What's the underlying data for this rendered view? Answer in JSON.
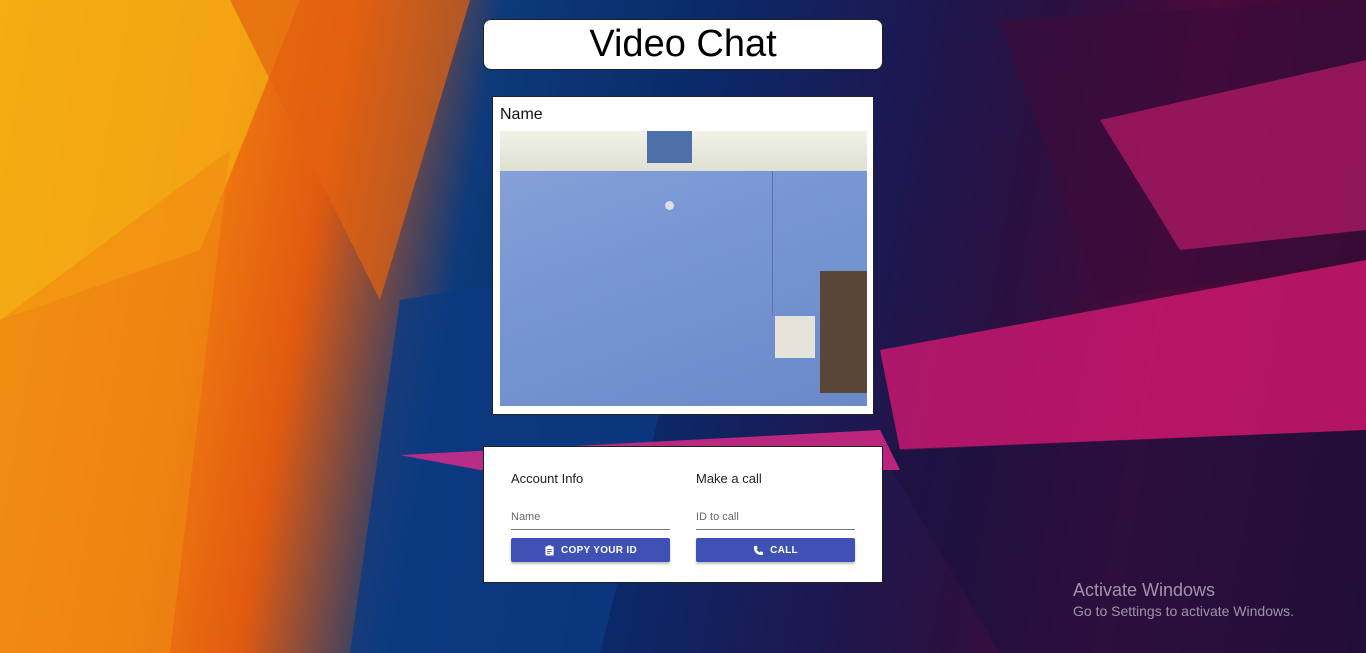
{
  "header": {
    "title": "Video Chat"
  },
  "video": {
    "name_label": "Name"
  },
  "account": {
    "title": "Account Info",
    "name_placeholder": "Name",
    "copy_button_label": "COPY YOUR ID"
  },
  "call": {
    "title": "Make a call",
    "id_placeholder": "ID to call",
    "call_button_label": "CALL"
  },
  "watermark": {
    "title": "Activate Windows",
    "subtitle": "Go to Settings to activate Windows."
  },
  "colors": {
    "button": "#3f51b5",
    "card": "#ffffff"
  },
  "icons": {
    "copy": "clipboard-icon",
    "call": "phone-icon"
  }
}
